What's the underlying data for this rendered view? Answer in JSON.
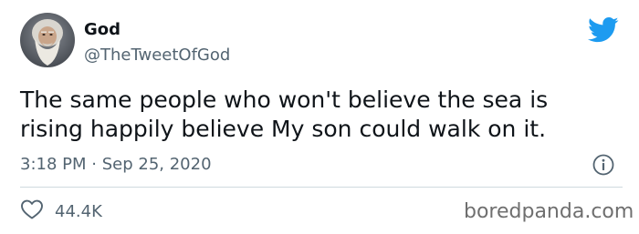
{
  "tweet": {
    "author": {
      "display_name": "God",
      "handle": "@TheTweetOfGod",
      "avatar_icon": "bearded-man-avatar"
    },
    "brand_icon": "twitter-bird-icon",
    "accent_color": "#1d9bf0",
    "text_lines": [
      "The same people who won't believe the sea is",
      "rising happily believe My son could walk on it."
    ],
    "time": "3:18 PM",
    "separator": "·",
    "date": "Sep 25, 2020",
    "info_icon": "info-icon",
    "likes": {
      "icon": "heart-icon",
      "count": "44.4K"
    }
  },
  "watermark": "boredpanda.com"
}
